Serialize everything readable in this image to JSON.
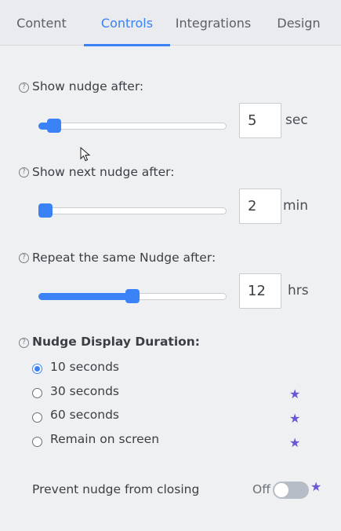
{
  "tabs": [
    "Content",
    "Controls",
    "Integrations",
    "Design"
  ],
  "active_tab": "Controls",
  "accent_color": "#3b82f6",
  "premium_star_color": "#6b57d6",
  "controls": {
    "show_nudge_after": {
      "label": "Show nudge after:",
      "value": "5",
      "unit": "sec",
      "slider_level_pct": 8
    },
    "show_next_nudge_after": {
      "label": "Show next nudge after:",
      "value": "2",
      "unit": "min",
      "slider_level_pct": 0
    },
    "repeat_same_nudge_after": {
      "label": "Repeat the same Nudge after:",
      "value": "12",
      "unit": "hrs",
      "slider_level_pct": 50
    }
  },
  "display_duration": {
    "label": "Nudge Display Duration:",
    "selected": "10 seconds",
    "options": [
      {
        "label": "10 seconds",
        "premium": false
      },
      {
        "label": "30 seconds",
        "premium": true
      },
      {
        "label": "60 seconds",
        "premium": true
      },
      {
        "label": "Remain on screen",
        "premium": true
      }
    ]
  },
  "prevent_closing": {
    "label": "Prevent nudge from closing",
    "state_text": "Off",
    "enabled": false,
    "premium": true
  },
  "icons": {
    "help": "question-circle-icon",
    "premium": "star-icon",
    "cursor": "mouse-pointer-icon"
  }
}
